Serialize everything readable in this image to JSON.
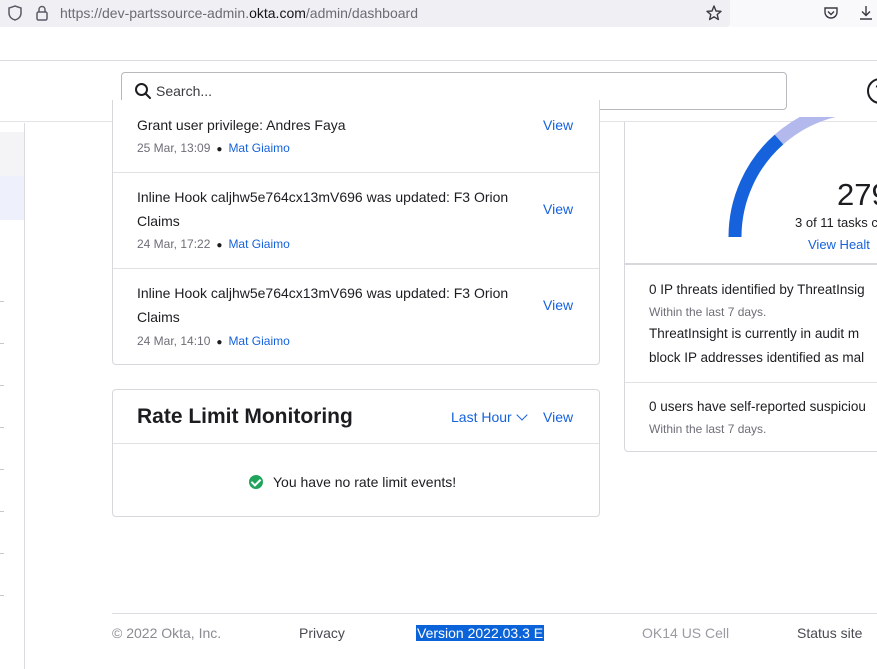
{
  "browser": {
    "url_prefix": "https://dev-partssource-admin.",
    "url_domain": "okta.com",
    "url_path": "/admin/dashboard"
  },
  "header": {
    "search_placeholder": "Search...",
    "help_glyph": "?"
  },
  "events": [
    {
      "title": "Grant user privilege: Andres Faya",
      "time": "25 Mar, 13:09",
      "actor": "Mat Giaimo",
      "view_label": "View"
    },
    {
      "title": "Inline Hook caljhw5e764cx13mV696 was updated: F3 Orion Claims",
      "time": "24 Mar, 17:22",
      "actor": "Mat Giaimo",
      "view_label": "View"
    },
    {
      "title": "Inline Hook caljhw5e764cx13mV696 was updated: F3 Orion Claims",
      "time": "24 Mar, 14:10",
      "actor": "Mat Giaimo",
      "view_label": "View"
    }
  ],
  "rate_limit": {
    "title": "Rate Limit Monitoring",
    "range_label": "Last Hour",
    "view_label": "View",
    "empty_message": "You have no rate limit events!"
  },
  "health": {
    "score_text": "279",
    "tasks_text": "3 of 11 tasks c",
    "link_label": "View Healt",
    "gauge_value": 0.27,
    "gauge_fill_color": "#1662dd",
    "gauge_track_color": "#b3b9ec"
  },
  "threats": {
    "ip_title": "0 IP threats identified by ThreatInsig",
    "ip_sub": "Within the last 7 days.",
    "ip_body_1": "ThreatInsight is currently in audit m",
    "ip_body_2": "block IP addresses identified as mal",
    "users_title": "0 users have self-reported suspiciou",
    "users_sub": "Within the last 7 days."
  },
  "footer": {
    "copyright": "© 2022 Okta, Inc.",
    "privacy": "Privacy",
    "version": "Version 2022.03.3 E",
    "cell": "OK14 US Cell",
    "status": "Status site"
  },
  "colors": {
    "link": "#1662dd",
    "success": "#1fa55b",
    "selection": "#0a63d8"
  }
}
